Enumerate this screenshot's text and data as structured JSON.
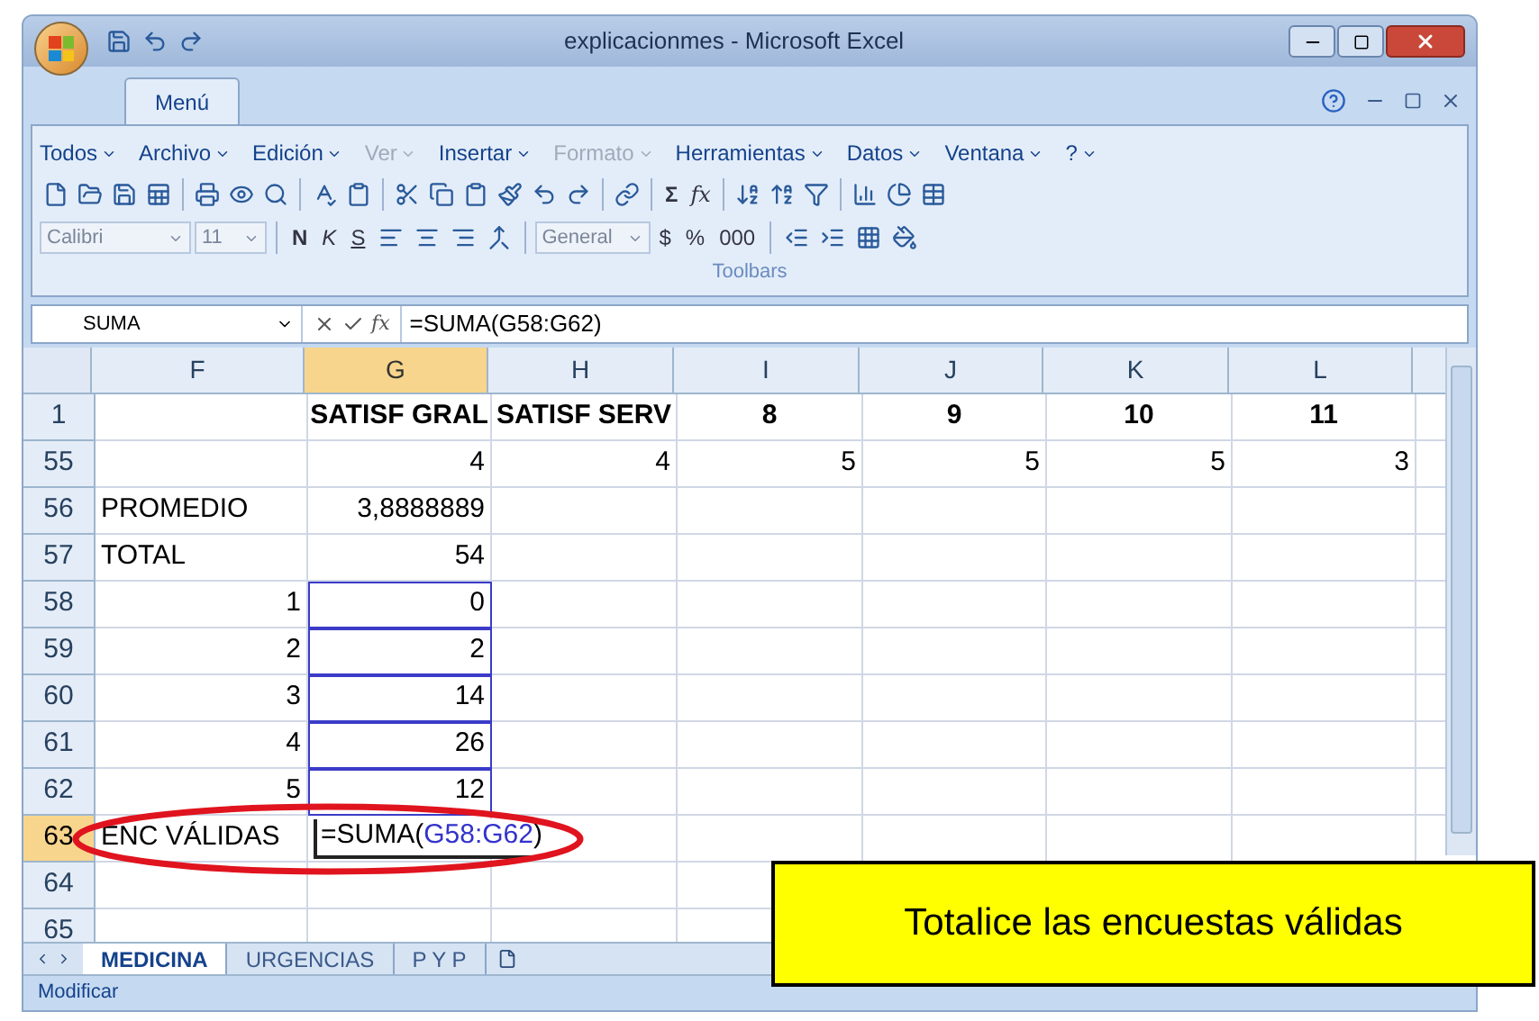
{
  "window": {
    "title": "explicacionmes - Microsoft Excel"
  },
  "ribbon_tab": {
    "label": "Menú",
    "selected": true
  },
  "menus": [
    {
      "label": "Todos",
      "disabled": false
    },
    {
      "label": "Archivo",
      "disabled": false
    },
    {
      "label": "Edición",
      "disabled": false
    },
    {
      "label": "Ver",
      "disabled": true
    },
    {
      "label": "Insertar",
      "disabled": false
    },
    {
      "label": "Formato",
      "disabled": true
    },
    {
      "label": "Herramientas",
      "disabled": false
    },
    {
      "label": "Datos",
      "disabled": false
    },
    {
      "label": "Ventana",
      "disabled": false
    },
    {
      "label": "?",
      "disabled": false
    }
  ],
  "toolbar": {
    "font": "Calibri",
    "size": "11",
    "bold": "N",
    "italic": "K",
    "underline": "S",
    "number_format": "General",
    "currency": "$",
    "percent": "%",
    "sum": "Σ",
    "function": "fx",
    "thousands": "000",
    "group_label": "Toolbars"
  },
  "formula_bar": {
    "name_box": "SUMA",
    "function": "fx",
    "formula": "=SUMA(G58:G62)"
  },
  "columns": [
    {
      "label": "F",
      "selected": false
    },
    {
      "label": "G",
      "selected": true
    },
    {
      "label": "H",
      "selected": false
    },
    {
      "label": "I",
      "selected": false
    },
    {
      "label": "J",
      "selected": false
    },
    {
      "label": "K",
      "selected": false
    },
    {
      "label": "L",
      "selected": false
    }
  ],
  "rows": [
    {
      "number": "1",
      "selected": false,
      "kind": "header",
      "cells": [
        null,
        {
          "text": "SATISF GRAL"
        },
        {
          "text": "SATISF SERV"
        },
        {
          "text": "8"
        },
        {
          "text": "9"
        },
        {
          "text": "10"
        },
        {
          "text": "11"
        }
      ]
    },
    {
      "number": "55",
      "selected": false,
      "kind": "data",
      "cells": [
        null,
        {
          "text": "4",
          "kind": "number"
        },
        {
          "text": "4",
          "kind": "number"
        },
        {
          "text": "5",
          "kind": "number"
        },
        {
          "text": "5",
          "kind": "number"
        },
        {
          "text": "5",
          "kind": "number"
        },
        {
          "text": "3",
          "kind": "number"
        }
      ]
    },
    {
      "number": "56",
      "selected": false,
      "kind": "data",
      "cells": [
        {
          "text": "PROMEDIO",
          "kind": "text"
        },
        {
          "text": "3,8888889",
          "kind": "number"
        },
        null,
        null,
        null,
        null,
        null
      ]
    },
    {
      "number": "57",
      "selected": false,
      "kind": "data",
      "cells": [
        {
          "text": "TOTAL",
          "kind": "text"
        },
        {
          "text": "54",
          "kind": "number"
        },
        null,
        null,
        null,
        null,
        null
      ]
    },
    {
      "number": "58",
      "selected": false,
      "kind": "data",
      "cells": [
        {
          "text": "1",
          "kind": "number"
        },
        {
          "text": "0",
          "kind": "number",
          "referenced": true
        },
        null,
        null,
        null,
        null,
        null
      ]
    },
    {
      "number": "59",
      "selected": false,
      "kind": "data",
      "cells": [
        {
          "text": "2",
          "kind": "number"
        },
        {
          "text": "2",
          "kind": "number",
          "referenced": true
        },
        null,
        null,
        null,
        null,
        null
      ]
    },
    {
      "number": "60",
      "selected": false,
      "kind": "data",
      "cells": [
        {
          "text": "3",
          "kind": "number"
        },
        {
          "text": "14",
          "kind": "number",
          "referenced": true
        },
        null,
        null,
        null,
        null,
        null
      ]
    },
    {
      "number": "61",
      "selected": false,
      "kind": "data",
      "cells": [
        {
          "text": "4",
          "kind": "number"
        },
        {
          "text": "26",
          "kind": "number",
          "referenced": true
        },
        null,
        null,
        null,
        null,
        null
      ]
    },
    {
      "number": "62",
      "selected": false,
      "kind": "data",
      "cells": [
        {
          "text": "5",
          "kind": "number"
        },
        {
          "text": "12",
          "kind": "number",
          "referenced": true
        },
        null,
        null,
        null,
        null,
        null
      ]
    },
    {
      "number": "63",
      "selected": true,
      "kind": "data",
      "cells": [
        {
          "text": "ENC VÁLIDAS",
          "kind": "text"
        },
        {
          "kind": "formula",
          "parts": [
            {
              "text": "=SUMA("
            },
            {
              "text": "G58:G62",
              "color": "#3333cc"
            },
            {
              "text": ")"
            }
          ]
        },
        null,
        null,
        null,
        null,
        null
      ]
    },
    {
      "number": "64",
      "selected": false,
      "kind": "data",
      "cells": [
        null,
        null,
        null,
        null,
        null,
        null,
        null
      ]
    },
    {
      "number": "65",
      "selected": false,
      "kind": "data",
      "cells": [
        null,
        null,
        null,
        null,
        null,
        null,
        null
      ]
    }
  ],
  "sheet_tabs": [
    {
      "label": "MEDICINA",
      "selected": true
    },
    {
      "label": "URGENCIAS",
      "selected": false
    },
    {
      "label": "P Y P",
      "selected": false
    }
  ],
  "status_bar": {
    "mode": "Modificar"
  },
  "callout": {
    "text": "Totalice las encuestas válidas"
  }
}
